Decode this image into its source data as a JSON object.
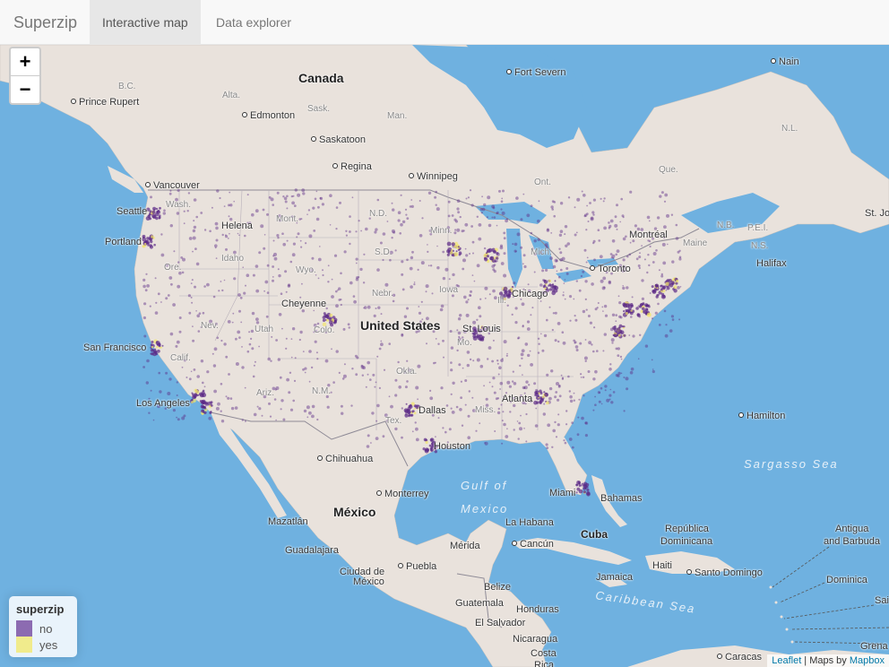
{
  "navbar": {
    "brand": "Superzip",
    "tabs": [
      {
        "label": "Interactive map",
        "active": true
      },
      {
        "label": "Data explorer",
        "active": false
      }
    ]
  },
  "zoom": {
    "in": "+",
    "out": "−"
  },
  "labels": {
    "countries": [
      "Canada",
      "United States",
      "México"
    ],
    "waters": [
      "Gulf of",
      "Mexico",
      "Sargasso Sea",
      "Caribbean Sea"
    ],
    "provinces": [
      "B.C.",
      "Alta.",
      "Sask.",
      "Man.",
      "Ont.",
      "Que.",
      "N.L.",
      "Wash.",
      "Mont.",
      "N.D.",
      "Minn.",
      "Mich.",
      "Idaho",
      "Ore.",
      "Wyo.",
      "S.D.",
      "Nebr.",
      "Iowa",
      "Nev.",
      "Utah",
      "Colo.",
      "Calif.",
      "Ariz.",
      "N.M.",
      "Okla.",
      "Tex.",
      "Mo.",
      "Miss.",
      "Ill.",
      "N.B.",
      "P.E.I.",
      "N.S.",
      "Maine"
    ],
    "cities": [
      "Nain",
      "Fort Severn",
      "Prince Rupert",
      "Edmonton",
      "Saskatoon",
      "Regina",
      "Winnipeg",
      "Vancouver",
      "Seattle",
      "Helena",
      "Portland",
      "Cheyenne",
      "San Francisco",
      "Los Angeles",
      "Chicago",
      "St. Louis",
      "Toronto",
      "Montréal",
      "Halifax",
      "St. Jo",
      "Atlanta",
      "Dallas",
      "Houston",
      "Miami",
      "Hamilton",
      "Chihuahua",
      "Monterrey",
      "Mazatlán",
      "Guadalajara",
      "Ciudad de",
      "México",
      "Puebla",
      "Mérida",
      "Cancún",
      "La Habana",
      "Cuba",
      "Bahamas",
      "República",
      "Dominicana",
      "Haiti",
      "Santo Domingo",
      "Jamaica",
      "Belize",
      "Guatemala",
      "Honduras",
      "El Salvador",
      "Nicaragua",
      "Costa",
      "Rica",
      "Caracas",
      "Antigua",
      "and Barbuda",
      "Dominica",
      "Sai",
      "Grena"
    ]
  },
  "legend": {
    "title": "superzip",
    "items": [
      {
        "label": "no",
        "color": "#8c6bb1"
      },
      {
        "label": "yes",
        "color": "#f0eb8c"
      }
    ]
  },
  "attribution": {
    "leaflet": "Leaflet",
    "sep": " | Maps by ",
    "mapbox": "Mapbox"
  },
  "colors": {
    "water": "#6fb1e0",
    "land": "#e9e2dc",
    "dot": "#5b2a86",
    "superzip": "#f2e66b"
  }
}
